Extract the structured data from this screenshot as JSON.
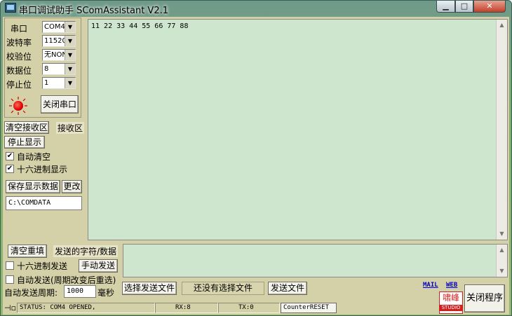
{
  "window": {
    "title": "串口调试助手 SComAssistant V2.1",
    "controls": {
      "minimize": "▁",
      "maximize": "□",
      "close": "✕"
    }
  },
  "serial": {
    "port_label": "串口",
    "port_value": "COM4",
    "baud_label": "波特率",
    "baud_value": "11520",
    "parity_label": "校验位",
    "parity_value": "无NON",
    "databits_label": "数据位",
    "databits_value": "8",
    "stopbits_label": "停止位",
    "stopbits_value": "1",
    "led_color": "#e00000",
    "close_port_label": "关闭串口"
  },
  "receive": {
    "clear_label": "清空接收区",
    "area_label": "接收区",
    "stop_display_label": "停止显示",
    "auto_clear_label": "自动清空",
    "auto_clear_checked": true,
    "hex_display_label": "十六进制显示",
    "hex_display_checked": true,
    "save_label": "保存显示数据",
    "change_label": "更改",
    "save_path": "C:\\COMDATA",
    "content": "11 22 33 44 55 66 77 88"
  },
  "send": {
    "clear_label": "清空重填",
    "area_label": "发送的字符/数据",
    "hex_send_label": "十六进制发送",
    "hex_send_checked": false,
    "manual_send_label": "手动发送",
    "auto_send_label": "自动发送(周期改变后重选)",
    "auto_send_checked": false,
    "period_label": "自动发送周期:",
    "period_value": "1000",
    "period_unit": "毫秒",
    "select_file_label": "选择发送文件",
    "file_status": "还没有选择文件",
    "send_file_label": "发送文件",
    "content": ""
  },
  "links": {
    "mail": "MAIL",
    "web": "WEB"
  },
  "logo": {
    "top": "啸峰",
    "bottom": "STUDIO"
  },
  "close_program_label": "关闭程序",
  "status": {
    "status_text": "STATUS: COM4 OPENED,",
    "rx": "RX:8",
    "tx": "TX:0",
    "counter_reset": "CounterRESET"
  }
}
